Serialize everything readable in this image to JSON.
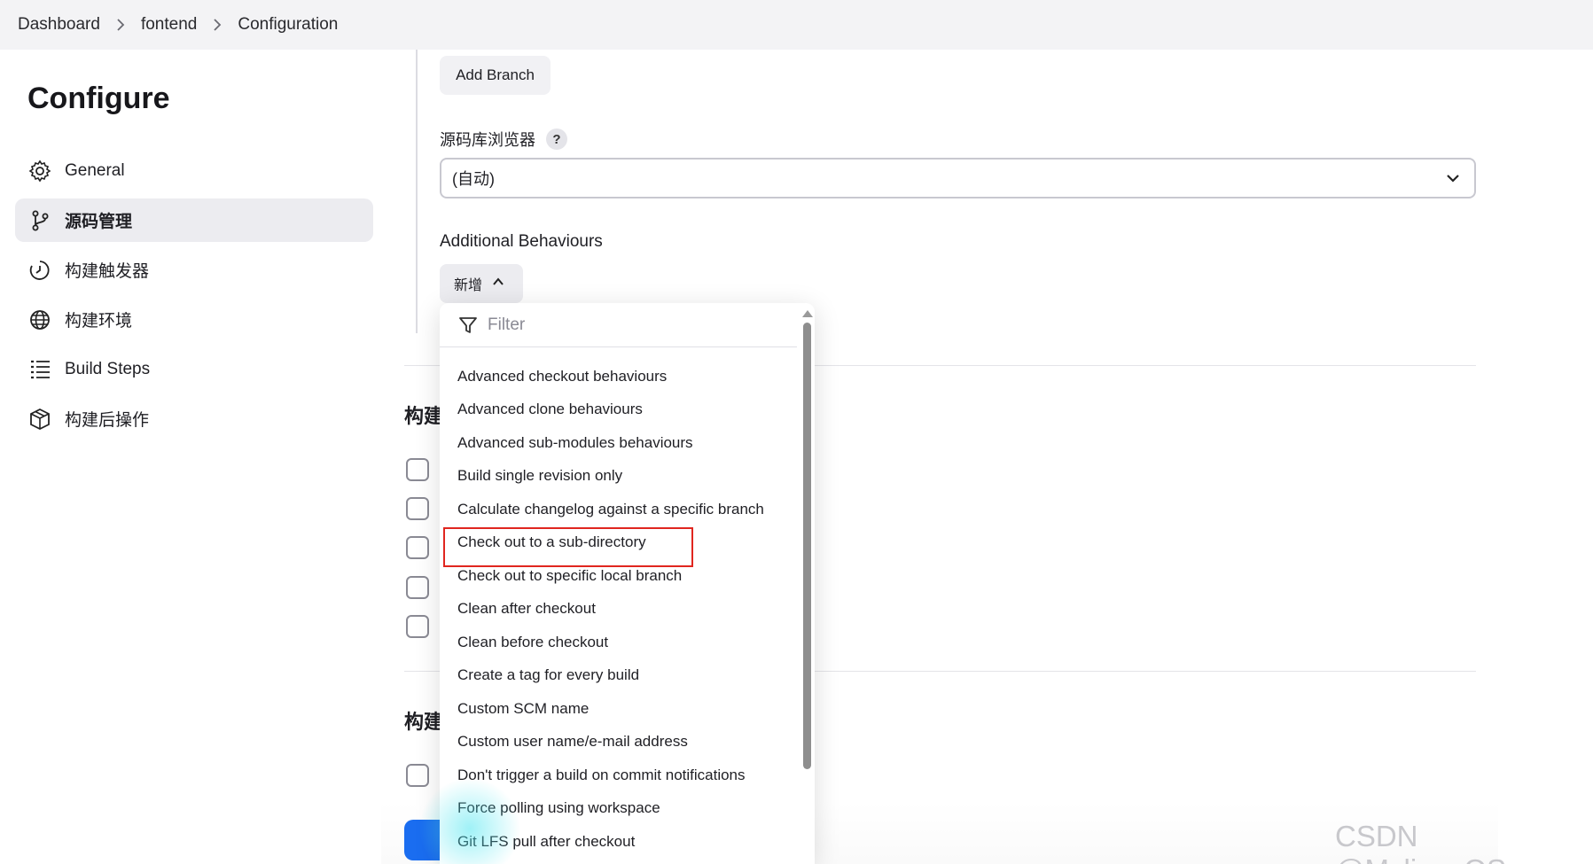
{
  "breadcrumb": {
    "items": [
      "Dashboard",
      "fontend",
      "Configuration"
    ]
  },
  "sidebar": {
    "title": "Configure",
    "items": [
      {
        "label": "General",
        "icon": "gear-icon",
        "active": false
      },
      {
        "label": "源码管理",
        "icon": "git-branch-icon",
        "active": true
      },
      {
        "label": "构建触发器",
        "icon": "clock-icon",
        "active": false
      },
      {
        "label": "构建环境",
        "icon": "globe-icon",
        "active": false
      },
      {
        "label": "Build Steps",
        "icon": "list-icon",
        "active": false
      },
      {
        "label": "构建后操作",
        "icon": "package-icon",
        "active": false
      }
    ]
  },
  "scm": {
    "add_branch_label": "Add Branch",
    "browser_label": "源码库浏览器",
    "help_label": "?",
    "browser_value": "(自动)",
    "additional_behaviours_label": "Additional Behaviours",
    "add_label": "新增"
  },
  "sections": {
    "triggers_heading": "构建",
    "env_heading": "构建"
  },
  "dropdown": {
    "filter_placeholder": "Filter",
    "items": [
      "Advanced checkout behaviours",
      "Advanced clone behaviours",
      "Advanced sub-modules behaviours",
      "Build single revision only",
      "Calculate changelog against a specific branch",
      "Check out to a sub-directory",
      "Check out to specific local branch",
      "Clean after checkout",
      "Clean before checkout",
      "Create a tag for every build",
      "Custom SCM name",
      "Custom user name/e-mail address",
      "Don't trigger a build on commit notifications",
      "Force polling using workspace",
      "Git LFS pull after checkout"
    ],
    "highlighted_item": "Check out to a sub-directory"
  },
  "colors": {
    "highlight_border": "#e0261f",
    "primary_button": "#1a6df0"
  },
  "watermark": "CSDN @MylinuxOS"
}
